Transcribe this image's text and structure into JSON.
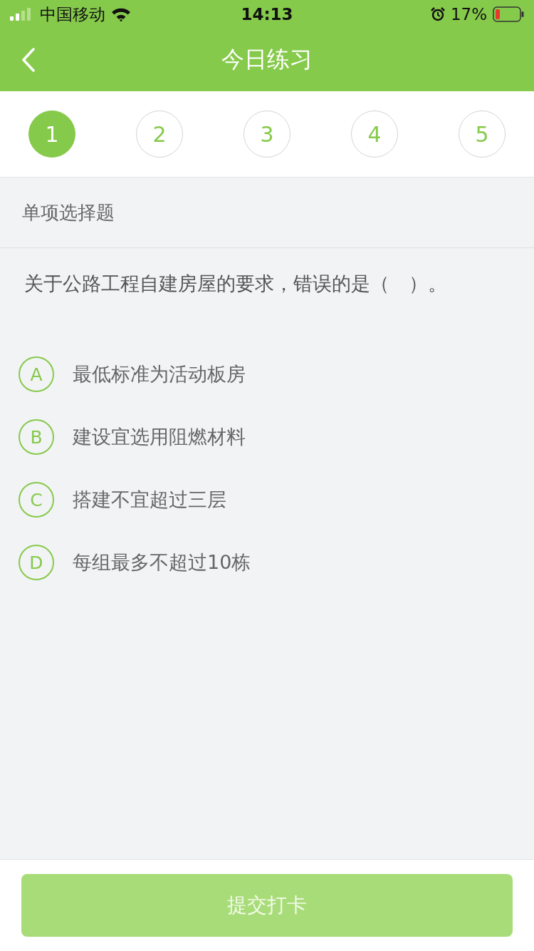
{
  "status_bar": {
    "carrier": "中国移动",
    "time": "14:13",
    "battery": "17%"
  },
  "nav": {
    "title": "今日练习"
  },
  "steps": [
    {
      "label": "1",
      "selected": true
    },
    {
      "label": "2",
      "selected": false
    },
    {
      "label": "3",
      "selected": false
    },
    {
      "label": "4",
      "selected": false
    },
    {
      "label": "5",
      "selected": false
    }
  ],
  "question_type": "单项选择题",
  "question": "关于公路工程自建房屋的要求，错误的是（　）。",
  "options": [
    {
      "letter": "A",
      "text": "最低标准为活动板房",
      "selected": false
    },
    {
      "letter": "B",
      "text": "建设宜选用阻燃材料",
      "selected": false
    },
    {
      "letter": "C",
      "text": "搭建不宜超过三层",
      "selected": false
    },
    {
      "letter": "D",
      "text": "每组最多不超过10栋",
      "selected": false
    }
  ],
  "submit": {
    "label": "提交打卡",
    "disabled": true
  }
}
